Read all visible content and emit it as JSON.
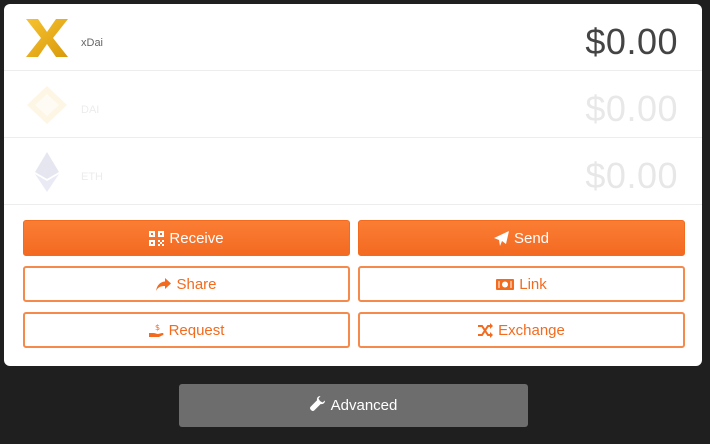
{
  "assets": [
    {
      "name": "xDai",
      "balance": "$0.00",
      "icon": "xdai-logo-icon"
    },
    {
      "name": "DAI",
      "balance": "$0.00",
      "icon": "dai-logo-icon"
    },
    {
      "name": "ETH",
      "balance": "$0.00",
      "icon": "eth-logo-icon"
    }
  ],
  "actions": {
    "receive": {
      "label": "Receive",
      "icon": "qrcode-icon"
    },
    "send": {
      "label": "Send",
      "icon": "paper-plane-icon"
    },
    "share": {
      "label": "Share",
      "icon": "share-arrow-icon"
    },
    "link": {
      "label": "Link",
      "icon": "money-bill-icon"
    },
    "request": {
      "label": "Request",
      "icon": "hand-coin-icon"
    },
    "exchange": {
      "label": "Exchange",
      "icon": "shuffle-icon"
    }
  },
  "advanced": {
    "label": "Advanced",
    "icon": "wrench-icon"
  },
  "colors": {
    "accent": "#f26b1f",
    "background": "#1f1f1f",
    "advanced_button": "#6d6d6d"
  }
}
